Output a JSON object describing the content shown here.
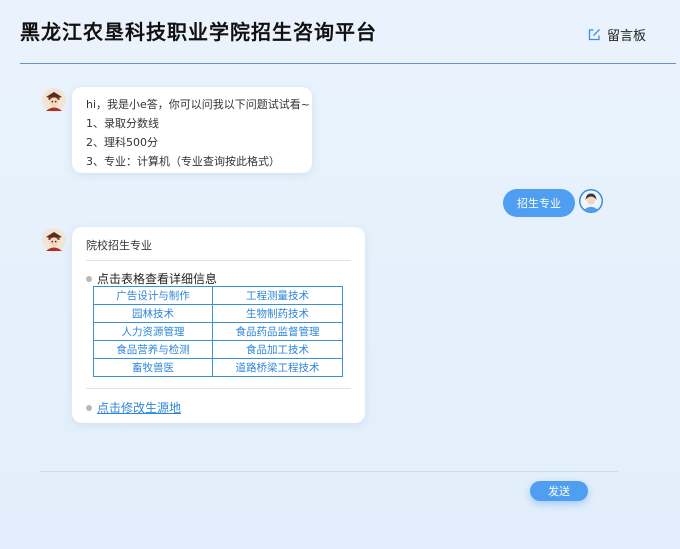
{
  "header": {
    "title": "黑龙江农垦科技职业学院招生咨询平台",
    "message_board_label": "留言板",
    "message_board_icon": "edit-icon"
  },
  "colors": {
    "accent": "#4f9ef2",
    "link": "#2e86d9",
    "table_border": "#3d8fd6",
    "header_rule": "#5f97cf"
  },
  "chat": {
    "bot_avatar_icon": "mascot-avatar-icon",
    "user_avatar_icon": "user-avatar-icon",
    "greeting": {
      "lines": [
        "hi，我是小e答，你可以问我以下问题试试看~",
        "1、录取分数线",
        "2、理科500分",
        "3、专业：计算机（专业查询按此格式）"
      ]
    },
    "user_message": "招生专业",
    "reply": {
      "heading": "院校招生专业",
      "tip": "点击表格查看详细信息",
      "majors": [
        [
          "广告设计与制作",
          "工程测量技术"
        ],
        [
          "园林技术",
          "生物制药技术"
        ],
        [
          "人力资源管理",
          "食品药品监督管理"
        ],
        [
          "食品营养与检测",
          "食品加工技术"
        ],
        [
          "畜牧兽医",
          "道路桥梁工程技术"
        ]
      ],
      "modify_link": "点击修改生源地"
    }
  },
  "composer": {
    "send_label": "发送"
  }
}
